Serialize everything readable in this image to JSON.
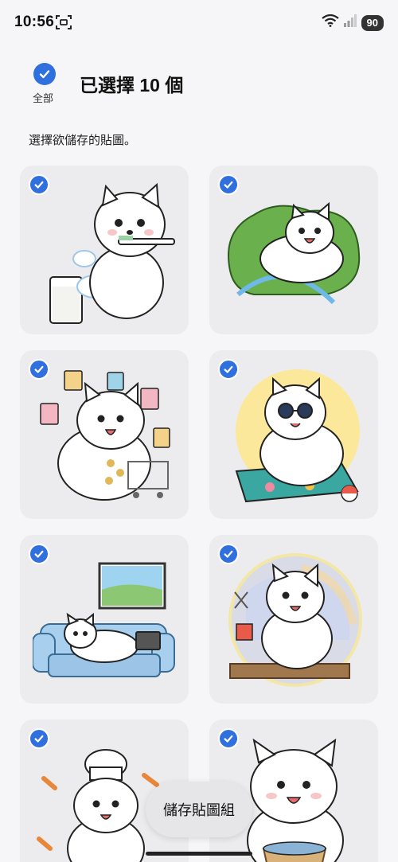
{
  "status": {
    "time": "10:56",
    "battery": "90"
  },
  "header": {
    "select_all_label": "全部",
    "title": "已選擇 10 個"
  },
  "subtitle": "選擇欲儲存的貼圖。",
  "stickers": [
    {
      "icon": "dog-brushing-teeth-sticker",
      "selected": true
    },
    {
      "icon": "dog-splash-sticker",
      "selected": true
    },
    {
      "icon": "dog-shopping-sticker",
      "selected": true
    },
    {
      "icon": "dog-sunbathing-sticker",
      "selected": true
    },
    {
      "icon": "dog-on-sofa-sticker",
      "selected": true
    },
    {
      "icon": "dog-crafting-sticker",
      "selected": true
    },
    {
      "icon": "dog-chef-sticker",
      "selected": true
    },
    {
      "icon": "dog-laundry-basket-sticker",
      "selected": true
    }
  ],
  "actions": {
    "save_label": "儲存貼圖組"
  },
  "colors": {
    "accent": "#2f6fde",
    "card_bg": "#ececee",
    "page_bg": "#f6f6f8"
  }
}
